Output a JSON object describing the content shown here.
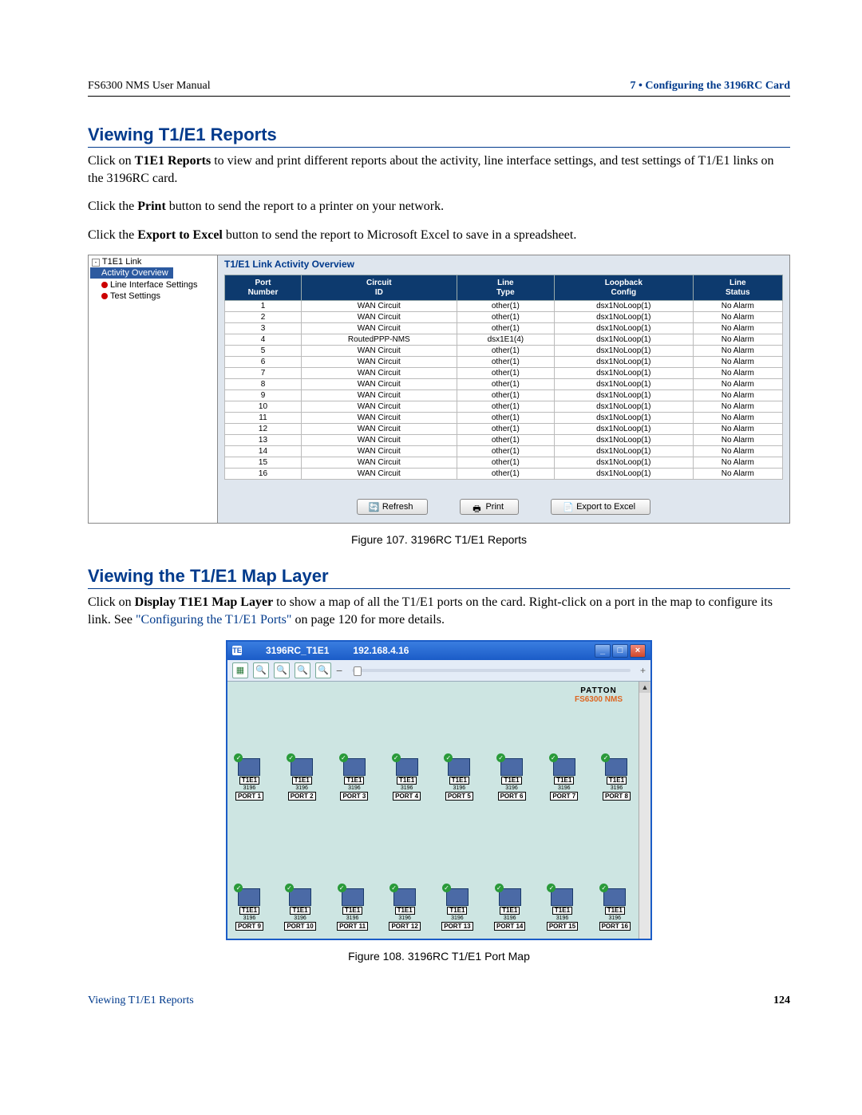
{
  "header": {
    "left": "FS6300 NMS User Manual",
    "right": "7 • Configuring the 3196RC Card"
  },
  "section1": {
    "title": "Viewing T1/E1 Reports",
    "p1a": "Click on ",
    "p1b": "T1E1 Reports",
    "p1c": " to view and print different reports about the activity, line interface settings, and test settings of T1/E1 links on the 3196RC card.",
    "p2a": "Click the ",
    "p2b": "Print",
    "p2c": " button to send the report to a printer on your network.",
    "p3a": "Click the ",
    "p3b": "Export to Excel",
    "p3c": " button to send the report to Microsoft Excel to save in a spreadsheet."
  },
  "report": {
    "tree_root": "T1E1 Link",
    "tree_items": [
      "Activity Overview",
      "Line Interface Settings",
      "Test Settings"
    ],
    "title": "T1/E1 Link Activity Overview",
    "columns": [
      "Port\nNumber",
      "Circuit\nID",
      "Line\nType",
      "Loopback\nConfig",
      "Line\nStatus"
    ],
    "rows": [
      {
        "port": "1",
        "circuit": "WAN Circuit",
        "line": "other(1)",
        "loop": "dsx1NoLoop(1)",
        "status": "No Alarm"
      },
      {
        "port": "2",
        "circuit": "WAN Circuit",
        "line": "other(1)",
        "loop": "dsx1NoLoop(1)",
        "status": "No Alarm"
      },
      {
        "port": "3",
        "circuit": "WAN Circuit",
        "line": "other(1)",
        "loop": "dsx1NoLoop(1)",
        "status": "No Alarm"
      },
      {
        "port": "4",
        "circuit": "RoutedPPP-NMS",
        "line": "dsx1E1(4)",
        "loop": "dsx1NoLoop(1)",
        "status": "No Alarm"
      },
      {
        "port": "5",
        "circuit": "WAN Circuit",
        "line": "other(1)",
        "loop": "dsx1NoLoop(1)",
        "status": "No Alarm"
      },
      {
        "port": "6",
        "circuit": "WAN Circuit",
        "line": "other(1)",
        "loop": "dsx1NoLoop(1)",
        "status": "No Alarm"
      },
      {
        "port": "7",
        "circuit": "WAN Circuit",
        "line": "other(1)",
        "loop": "dsx1NoLoop(1)",
        "status": "No Alarm"
      },
      {
        "port": "8",
        "circuit": "WAN Circuit",
        "line": "other(1)",
        "loop": "dsx1NoLoop(1)",
        "status": "No Alarm"
      },
      {
        "port": "9",
        "circuit": "WAN Circuit",
        "line": "other(1)",
        "loop": "dsx1NoLoop(1)",
        "status": "No Alarm"
      },
      {
        "port": "10",
        "circuit": "WAN Circuit",
        "line": "other(1)",
        "loop": "dsx1NoLoop(1)",
        "status": "No Alarm"
      },
      {
        "port": "11",
        "circuit": "WAN Circuit",
        "line": "other(1)",
        "loop": "dsx1NoLoop(1)",
        "status": "No Alarm"
      },
      {
        "port": "12",
        "circuit": "WAN Circuit",
        "line": "other(1)",
        "loop": "dsx1NoLoop(1)",
        "status": "No Alarm"
      },
      {
        "port": "13",
        "circuit": "WAN Circuit",
        "line": "other(1)",
        "loop": "dsx1NoLoop(1)",
        "status": "No Alarm"
      },
      {
        "port": "14",
        "circuit": "WAN Circuit",
        "line": "other(1)",
        "loop": "dsx1NoLoop(1)",
        "status": "No Alarm"
      },
      {
        "port": "15",
        "circuit": "WAN Circuit",
        "line": "other(1)",
        "loop": "dsx1NoLoop(1)",
        "status": "No Alarm"
      },
      {
        "port": "16",
        "circuit": "WAN Circuit",
        "line": "other(1)",
        "loop": "dsx1NoLoop(1)",
        "status": "No Alarm"
      }
    ],
    "buttons": {
      "refresh": "Refresh",
      "print": "Print",
      "export": "Export to Excel"
    }
  },
  "fig107": "Figure 107. 3196RC T1/E1 Reports",
  "section2": {
    "title": "Viewing the T1/E1 Map Layer",
    "p1a": "Click on ",
    "p1b": "Display T1E1 Map Layer",
    "p1c": " to show a map of all the T1/E1 ports on the card. Right-click on a port in the map to configure its link. See ",
    "p1d": "\"Configuring the T1/E1 Ports\"",
    "p1e": " on page 120 for more details."
  },
  "map": {
    "title_name": "3196RC_T1E1",
    "title_ip": "192.168.4.16",
    "brand_top": "PATTON",
    "brand_sub": "FS6300 NMS",
    "t1e1_label": "T1E1",
    "sub_label": "3196",
    "ports_row1": [
      "PORT 1",
      "PORT 2",
      "PORT 3",
      "PORT 4",
      "PORT 5",
      "PORT 6",
      "PORT 7",
      "PORT 8"
    ],
    "ports_row2": [
      "PORT 9",
      "PORT 10",
      "PORT 11",
      "PORT 12",
      "PORT 13",
      "PORT 14",
      "PORT 15",
      "PORT 16"
    ]
  },
  "fig108": "Figure 108. 3196RC T1/E1 Port Map",
  "footer": {
    "left": "Viewing T1/E1 Reports",
    "page": "124"
  }
}
